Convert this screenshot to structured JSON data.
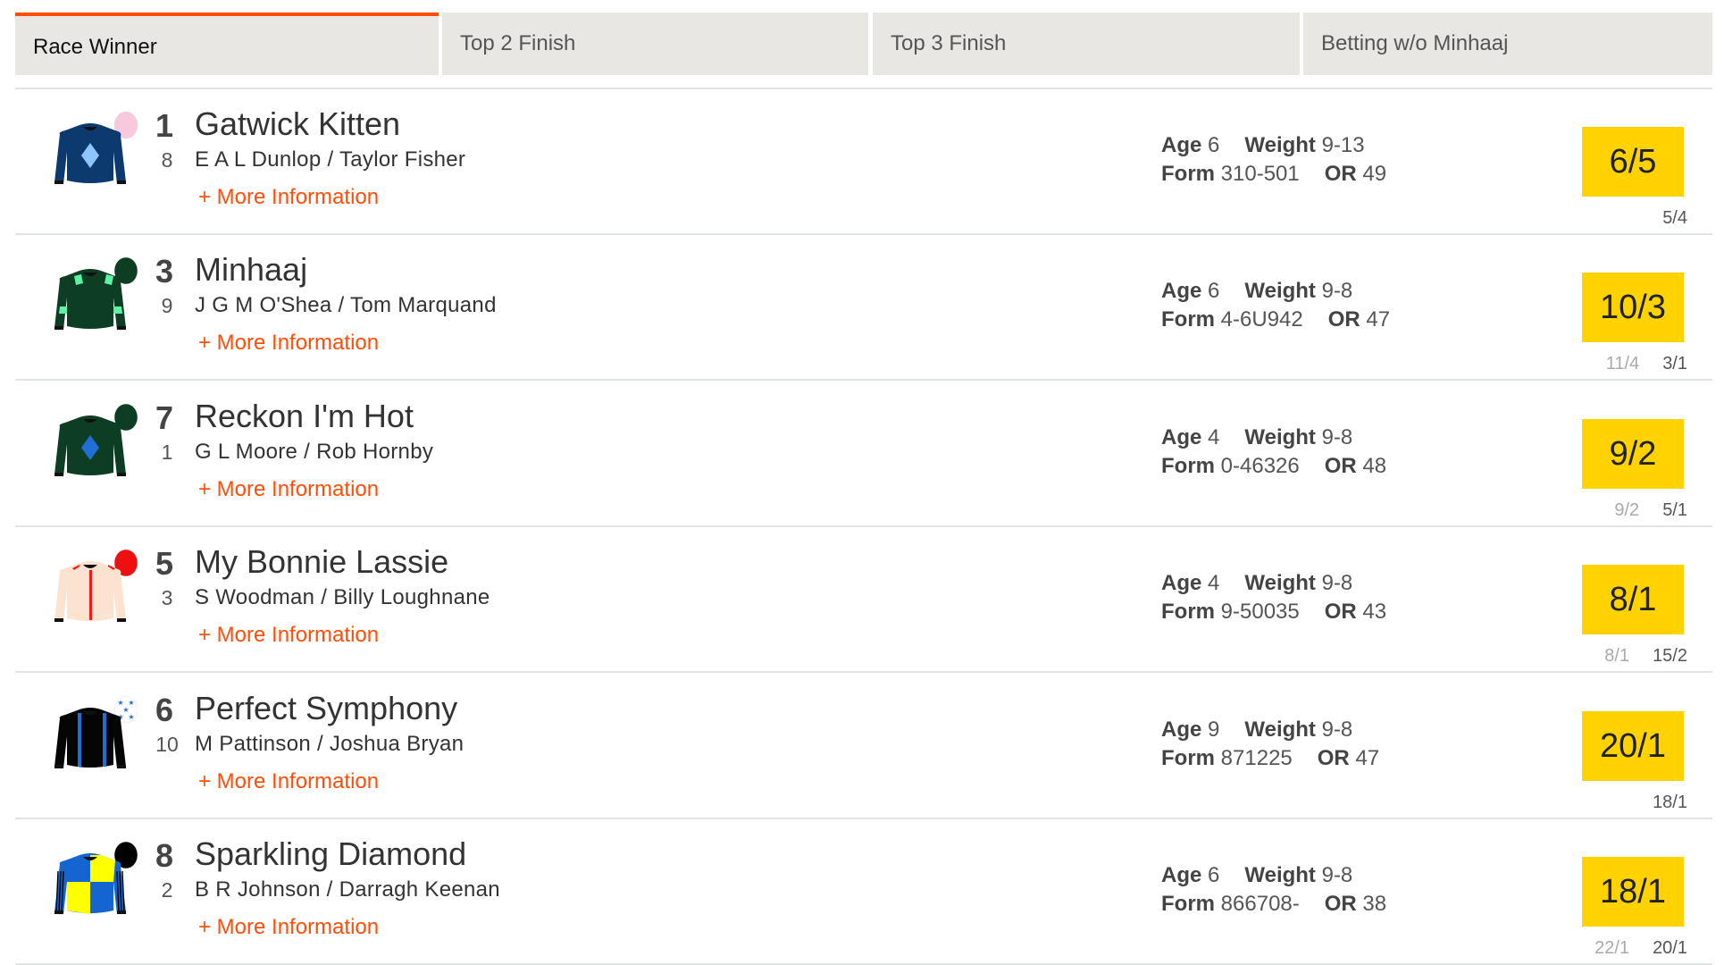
{
  "tabs": [
    {
      "label": "Race Winner",
      "active": true
    },
    {
      "label": "Top 2 Finish",
      "active": false
    },
    {
      "label": "Top 3 Finish",
      "active": false
    },
    {
      "label": "Betting w/o Minhaaj",
      "active": false
    }
  ],
  "colors": {
    "accent": "#ff4d0a",
    "odds_bg": "#ffd200",
    "tab_bg": "#e8e7e4"
  },
  "labels": {
    "age": "Age",
    "weight": "Weight",
    "form": "Form",
    "or": "OR",
    "more_info": "+ More Information"
  },
  "runners": [
    {
      "number": "1",
      "name": "Gatwick Kitten",
      "draw": "8",
      "trainer_jockey": "E A L Dunlop / Taylor Fisher",
      "age": "6",
      "weight": "9-13",
      "form": "310-501",
      "or": "49",
      "odds": "6/5",
      "prev_old": "",
      "prev": "5/4",
      "silk": {
        "icon": "jockey-silk-navy-light-blue-diamond",
        "body": "#0d3a6e",
        "pattern": "diamond",
        "pattern_color": "#8ec5ff",
        "cap": "#f8c8dc"
      }
    },
    {
      "number": "3",
      "name": "Minhaaj",
      "draw": "9",
      "trainer_jockey": "J G M O'Shea / Tom Marquand",
      "age": "6",
      "weight": "9-8",
      "form": "4-6U942",
      "or": "47",
      "odds": "10/3",
      "prev_old": "11/4",
      "prev": "3/1",
      "silk": {
        "icon": "jockey-silk-dark-green-mint-epaulets-armlets",
        "body": "#0d3d22",
        "pattern": "armlets",
        "pattern_color": "#5ef2a4",
        "cap": "#0d3d22"
      }
    },
    {
      "number": "7",
      "name": "Reckon I'm Hot",
      "draw": "1",
      "trainer_jockey": "G L Moore / Rob Hornby",
      "age": "4",
      "weight": "9-8",
      "form": "0-46326",
      "or": "48",
      "odds": "9/2",
      "prev_old": "9/2",
      "prev": "5/1",
      "silk": {
        "icon": "jockey-silk-dark-green-blue-diamond",
        "body": "#0d3d22",
        "pattern": "diamond",
        "pattern_color": "#1f6fd6",
        "cap": "#0d3d22"
      }
    },
    {
      "number": "5",
      "name": "My Bonnie Lassie",
      "draw": "3",
      "trainer_jockey": "S Woodman / Billy Loughnane",
      "age": "4",
      "weight": "9-8",
      "form": "9-50035",
      "or": "43",
      "odds": "8/1",
      "prev_old": "8/1",
      "prev": "15/2",
      "silk": {
        "icon": "jockey-silk-cream-red-braces",
        "body": "#fbe3d0",
        "pattern": "braces",
        "pattern_color": "#ee1c1c",
        "cap": "#ee1010"
      }
    },
    {
      "number": "6",
      "name": "Perfect Symphony",
      "draw": "10",
      "trainer_jockey": "M Pattinson / Joshua Bryan",
      "age": "9",
      "weight": "9-8",
      "form": "871225",
      "or": "47",
      "odds": "20/1",
      "prev_old": "",
      "prev": "18/1",
      "silk": {
        "icon": "jockey-silk-black-blue-braces-starred-cap",
        "body": "#050505",
        "pattern": "stripes2",
        "pattern_color": "#1f6fd6",
        "cap": "#ffffff",
        "cap_pattern": "stars"
      }
    },
    {
      "number": "8",
      "name": "Sparkling Diamond",
      "draw": "2",
      "trainer_jockey": "B R Johnson / Darragh Keenan",
      "age": "6",
      "weight": "9-8",
      "form": "866708-",
      "or": "38",
      "odds": "18/1",
      "prev_old": "22/1",
      "prev": "20/1",
      "silk": {
        "icon": "jockey-silk-blue-yellow-quartered-striped-sleeves",
        "body": "#1565d0",
        "pattern": "quartered",
        "pattern_color": "#ffff00",
        "cap": "#000000"
      }
    }
  ]
}
